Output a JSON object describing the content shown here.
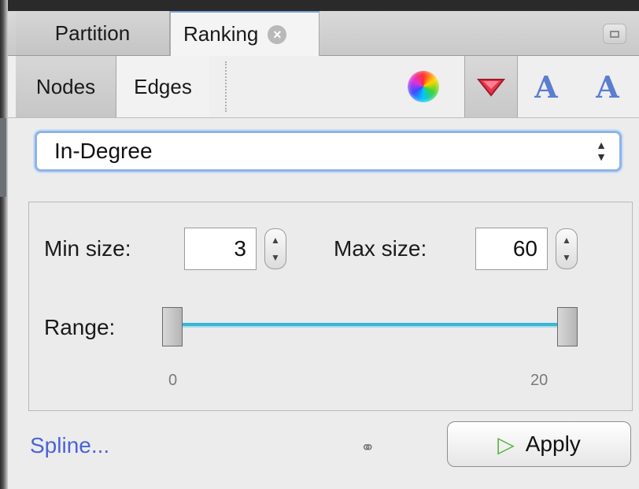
{
  "tabs": [
    {
      "label": "Partition",
      "active": false
    },
    {
      "label": "Ranking",
      "active": true
    }
  ],
  "subtabs": [
    {
      "label": "Nodes",
      "selected": true
    },
    {
      "label": "Edges",
      "selected": false
    }
  ],
  "toolbar_icons": [
    "color-wheel-icon",
    "size-diamond-icon",
    "label-color-icon",
    "label-size-icon"
  ],
  "ranking_attribute": "In-Degree",
  "min_size": {
    "label": "Min size:",
    "value": "3"
  },
  "max_size": {
    "label": "Max size:",
    "value": "60"
  },
  "range": {
    "label": "Range:",
    "min_label": "0",
    "max_label": "20",
    "low_value": 0,
    "high_value": 20
  },
  "spline_link": "Spline...",
  "apply_button": "Apply",
  "colors": {
    "accent": "#36b7d6",
    "link": "#4a63d8",
    "focus": "#8fb3e6",
    "apply_icon": "#55b33a"
  }
}
